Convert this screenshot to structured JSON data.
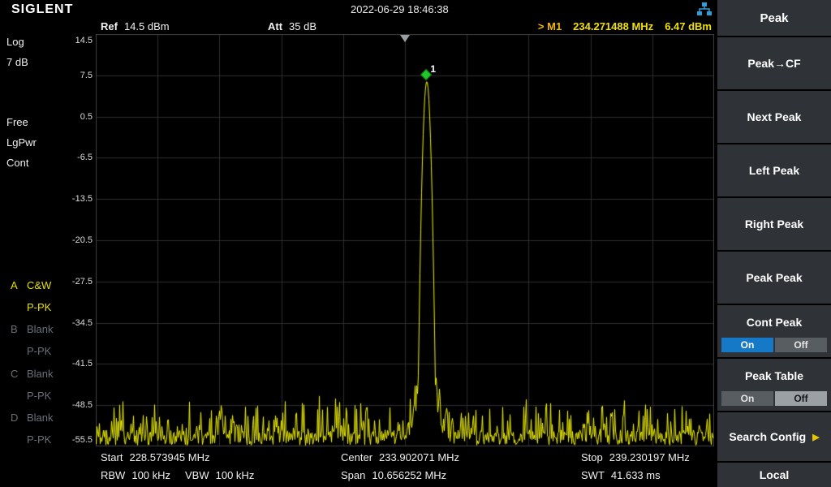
{
  "header": {
    "logo": "SIGLENT",
    "datetime": "2022-06-29 18:46:38"
  },
  "status_bar": {
    "ref_label": "Ref",
    "ref_value": "14.5 dBm",
    "att_label": "Att",
    "att_value": "35 dB",
    "marker_prefix": "> M1",
    "marker_freq": "234.271488 MHz",
    "marker_ampl": "6.47 dBm"
  },
  "left_panel": {
    "scale_type": "Log",
    "scale_div": "7 dB",
    "trigger": "Free",
    "power": "LgPwr",
    "sweep": "Cont",
    "traces": [
      {
        "id": "A",
        "mode": "C&W",
        "detector": "P-PK",
        "active": true
      },
      {
        "id": "B",
        "mode": "Blank",
        "detector": "P-PK",
        "active": false
      },
      {
        "id": "C",
        "mode": "Blank",
        "detector": "P-PK",
        "active": false
      },
      {
        "id": "D",
        "mode": "Blank",
        "detector": "P-PK",
        "active": false
      }
    ]
  },
  "chart_data": {
    "type": "line",
    "title": "Spectrum trace",
    "y_ticks": [
      "14.5",
      "7.5",
      "0.5",
      "-6.5",
      "-13.5",
      "-20.5",
      "-27.5",
      "-34.5",
      "-41.5",
      "-48.5",
      "-55.5"
    ],
    "ref_dbm": 14.5,
    "scale_db_per_div": 7,
    "ymin_dbm": -55.5,
    "start_mhz": 228.573945,
    "stop_mhz": 239.230197,
    "center_mhz": 233.902071,
    "span_mhz": 10.656252,
    "grid_divs": [
      10,
      10
    ],
    "trace_color": "#f2f200",
    "noise_floor_dbm_range": [
      -55.5,
      -45
    ],
    "peak_marker": {
      "id": "1",
      "freq_mhz": 234.271488,
      "ampl_dbm": 6.47
    }
  },
  "footer": {
    "start_label": "Start",
    "start_value": "228.573945 MHz",
    "center_label": "Center",
    "center_value": "233.902071 MHz",
    "stop_label": "Stop",
    "stop_value": "239.230197 MHz",
    "rbw_label": "RBW",
    "rbw_value": "100 kHz",
    "vbw_label": "VBW",
    "vbw_value": "100 kHz",
    "span_label": "Span",
    "span_value": "10.656252 MHz",
    "swt_label": "SWT",
    "swt_value": "41.633 ms"
  },
  "menu": {
    "title": "Peak",
    "items": [
      {
        "label": "Peak→CF"
      },
      {
        "label": "Next Peak"
      },
      {
        "label": "Left Peak"
      },
      {
        "label": "Right Peak"
      },
      {
        "label": "Peak Peak"
      },
      {
        "label": "Cont Peak",
        "on": "On",
        "off": "Off",
        "selected": "On"
      },
      {
        "label": "Peak Table",
        "on": "On",
        "off": "Off",
        "selected": "Off"
      },
      {
        "label": "Search Config"
      }
    ],
    "local": "Local"
  },
  "icons": {
    "submenu_arrow": "▶"
  }
}
